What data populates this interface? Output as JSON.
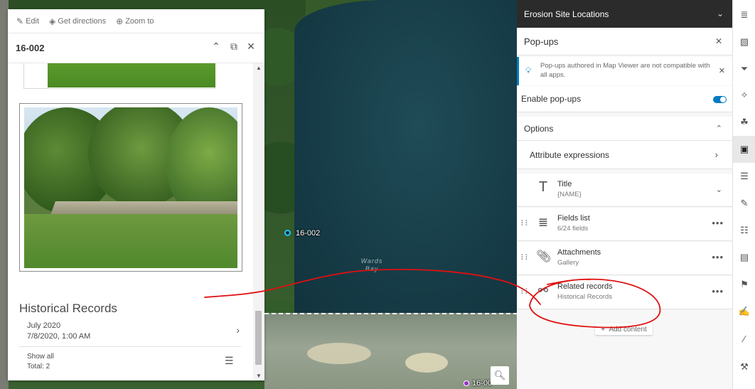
{
  "popup": {
    "actions": [
      {
        "label": "Edit",
        "icon": "edit-icon"
      },
      {
        "label": "Get directions",
        "icon": "directions-icon"
      },
      {
        "label": "Zoom to",
        "icon": "zoom-to-icon"
      }
    ],
    "title": "16-002",
    "historical_records": {
      "heading": "Historical Records",
      "item_title": "July 2020",
      "item_date": "7/8/2020, 1:00 AM",
      "show_all": "Show all",
      "total": "Total: 2"
    }
  },
  "map": {
    "point_label": "16-002",
    "bay_label_line1": "Wards",
    "bay_label_line2": "Bay",
    "bottom_label": "16-00",
    "colors": {
      "point": "#1ec8ff",
      "annotation": "#e01010"
    }
  },
  "config": {
    "layer_name": "Erosion Site Locations",
    "section_title": "Pop-ups",
    "notice": "Pop-ups authored in Map Viewer are not compatible with all apps.",
    "enable_label": "Enable pop-ups",
    "enable_on": true,
    "options_label": "Options",
    "attribute_expressions": "Attribute expressions",
    "blocks": [
      {
        "title": "Title",
        "subtitle": "{NAME}",
        "icon": "text-icon"
      },
      {
        "title": "Fields list",
        "subtitle": "6/24 fields",
        "icon": "fields-list-icon"
      },
      {
        "title": "Attachments",
        "subtitle": "Gallery",
        "icon": "paperclip-icon"
      },
      {
        "title": "Related records",
        "subtitle": "Historical Records",
        "icon": "related-records-icon"
      }
    ],
    "add_content": "Add content",
    "accent": "#007ac2"
  },
  "toolbar": {
    "icons": [
      "properties-icon",
      "styles-icon",
      "filter-icon",
      "effects-icon",
      "configure-clusters-icon",
      "popups-icon",
      "fields-icon",
      "sketch-icon",
      "analysis-icon",
      "forms-icon",
      "share-icon",
      "edit-icon",
      "measure-icon",
      "settings-icon"
    ],
    "active": "popups-icon"
  }
}
